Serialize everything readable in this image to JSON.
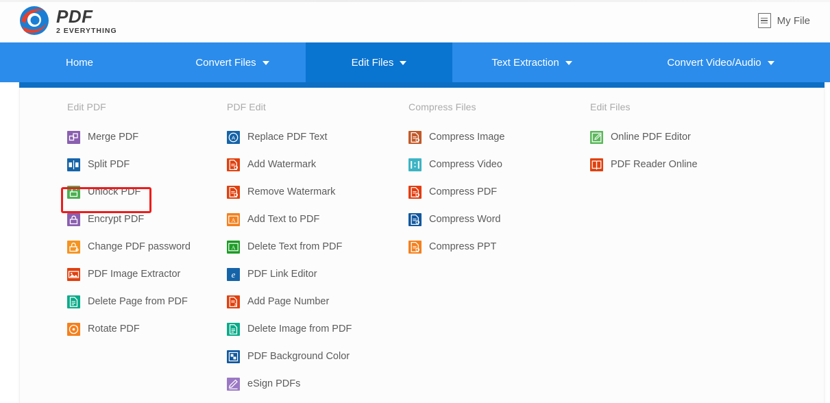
{
  "brand": {
    "name": "PDF",
    "tagline": "2 EVERYTHING",
    "logo_colors": {
      "blue": "#1a7fd4",
      "red": "#e8402a"
    }
  },
  "header": {
    "my_file_label": "My File",
    "my_file_icon": "list-document-icon"
  },
  "nav": {
    "background": "#2b8ceb",
    "active_background": "#0a74d1",
    "items": [
      {
        "label": "Home",
        "has_caret": false,
        "active": false
      },
      {
        "label": "Convert Files",
        "has_caret": true,
        "active": false
      },
      {
        "label": "Edit Files",
        "has_caret": true,
        "active": true
      },
      {
        "label": "Text Extraction",
        "has_caret": true,
        "active": false
      },
      {
        "label": "Convert Video/Audio",
        "has_caret": true,
        "active": false
      }
    ]
  },
  "dropdown": {
    "highlight_color": "#ee1c1c",
    "highlighted_item": "Encrypt PDF",
    "columns": [
      {
        "title": "Edit PDF",
        "items": [
          {
            "label": "Merge PDF",
            "icon": "merge-icon",
            "color": "#8a5fb0"
          },
          {
            "label": "Split PDF",
            "icon": "split-icon",
            "color": "#1664a8"
          },
          {
            "label": "Unlock PDF",
            "icon": "unlock-icon",
            "color": "#4caf50"
          },
          {
            "label": "Encrypt PDF",
            "icon": "lock-icon",
            "color": "#8a5fb0"
          },
          {
            "label": "Change PDF password",
            "icon": "key-lock-icon",
            "color": "#f59320"
          },
          {
            "label": "PDF Image Extractor",
            "icon": "image-extract-icon",
            "color": "#e0410f"
          },
          {
            "label": "Delete Page from PDF",
            "icon": "page-delete-icon",
            "color": "#0bab8a"
          },
          {
            "label": "Rotate PDF",
            "icon": "rotate-icon",
            "color": "#f4801e"
          }
        ]
      },
      {
        "title": "PDF Edit",
        "items": [
          {
            "label": "Replace PDF Text",
            "icon": "replace-text-icon",
            "color": "#1664a8"
          },
          {
            "label": "Add Watermark",
            "icon": "watermark-add-icon",
            "color": "#e0410f"
          },
          {
            "label": "Remove Watermark",
            "icon": "watermark-remove-icon",
            "color": "#e0410f"
          },
          {
            "label": "Add Text to PDF",
            "icon": "text-add-icon",
            "color": "#f4801e"
          },
          {
            "label": "Delete Text from PDF",
            "icon": "text-delete-icon",
            "color": "#1d9c27"
          },
          {
            "label": "PDF Link Editor",
            "icon": "link-editor-icon",
            "color": "#1664a8"
          },
          {
            "label": "Add Page Number",
            "icon": "page-number-icon",
            "color": "#e0410f"
          },
          {
            "label": "Delete Image from PDF",
            "icon": "image-delete-icon",
            "color": "#0bab8a"
          },
          {
            "label": "PDF Background Color",
            "icon": "background-color-icon",
            "color": "#12589e"
          },
          {
            "label": "eSign PDFs",
            "icon": "signature-icon",
            "color": "#9b78c4"
          }
        ]
      },
      {
        "title": "Compress Files",
        "items": [
          {
            "label": "Compress Image",
            "icon": "compress-image-icon",
            "color": "#c25a2a"
          },
          {
            "label": "Compress Video",
            "icon": "compress-video-icon",
            "color": "#3cb4c4"
          },
          {
            "label": "Compress PDF",
            "icon": "compress-pdf-icon",
            "color": "#e33d11"
          },
          {
            "label": "Compress Word",
            "icon": "compress-word-icon",
            "color": "#12589e"
          },
          {
            "label": "Compress PPT",
            "icon": "compress-ppt-icon",
            "color": "#f4801e"
          }
        ]
      },
      {
        "title": "Edit Files",
        "items": [
          {
            "label": "Online PDF Editor",
            "icon": "online-editor-icon",
            "color": "#5cb85c"
          },
          {
            "label": "PDF Reader Online",
            "icon": "reader-icon",
            "color": "#e0410f"
          }
        ]
      }
    ]
  }
}
